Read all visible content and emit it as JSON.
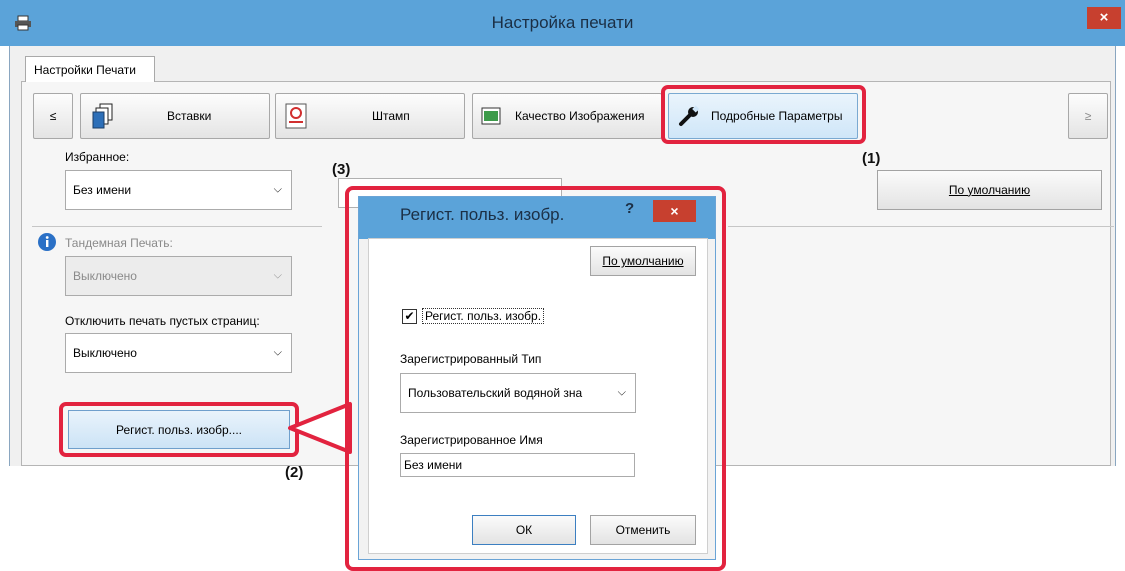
{
  "window": {
    "title": "Настройка печати",
    "close_glyph": "×"
  },
  "tab_label": "Настройки Печати",
  "toolbar": {
    "prev": "≤",
    "next": "≥",
    "inserts": "Вставки",
    "stamp": "Штамп",
    "image_quality": "Качество Изображения",
    "detailed": "Подробные Параметры"
  },
  "favorites": {
    "label": "Избранное:",
    "value": "Без имени",
    "default_button": "По умолчанию"
  },
  "tandem": {
    "label": "Тандемная Печать:",
    "value": "Выключено"
  },
  "blank_pages": {
    "label": "Отключить печать пустых страниц:",
    "value": "Выключено"
  },
  "register_button": "Регист. польз. изобр....",
  "callouts": [
    "(1)",
    "(2)",
    "(3)"
  ],
  "dialog": {
    "title": "Регист. польз. изобр.",
    "help": "?",
    "close": "×",
    "default_button": "По умолчанию",
    "checkbox_label": "Регист. польз. изобр.",
    "checkbox_checked": true,
    "type_label": "Зарегистрированный Тип",
    "type_value": "Пользовательский водяной зна",
    "name_label": "Зарегистрированное Имя",
    "name_value": "Без имени",
    "ok": "ОК",
    "cancel": "Отменить"
  },
  "icons": [
    "printer-icon",
    "inserts-icon",
    "stamp-icon",
    "image-quality-icon",
    "wrench-icon",
    "info-icon",
    "checkmark-icon",
    "chevron-down-icon"
  ],
  "colors": {
    "titlebar": "#5ba3d9",
    "close": "#c7402f",
    "highlight": "#e2233f"
  }
}
